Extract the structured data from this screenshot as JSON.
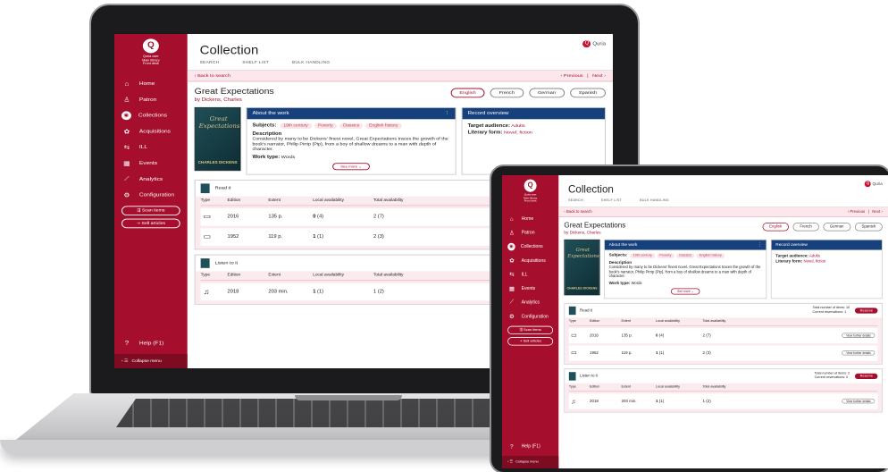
{
  "app": {
    "brand": {
      "lines": [
        "Quria user",
        "Main library",
        "Front desk"
      ],
      "logo_text": "Quria"
    },
    "sidebar": {
      "items": [
        {
          "label": "Home",
          "icon": "home-icon",
          "glyph": "⌂"
        },
        {
          "label": "Patron",
          "icon": "person-icon",
          "glyph": "♙"
        },
        {
          "label": "Collections",
          "icon": "collections-icon",
          "glyph": "◉",
          "active": true
        },
        {
          "label": "Acquisitions",
          "icon": "acquisitions-icon",
          "glyph": "✿"
        },
        {
          "label": "ILL",
          "icon": "ill-icon",
          "glyph": "⇆"
        },
        {
          "label": "Events",
          "icon": "calendar-icon",
          "glyph": "▦"
        },
        {
          "label": "Analytics",
          "icon": "chart-icon",
          "glyph": "⟋"
        },
        {
          "label": "Configuration",
          "icon": "gear-icon",
          "glyph": "⚙"
        }
      ],
      "scan_items": "Scan items",
      "sell_articles": "Sell articles",
      "help": "Help (F1)",
      "collapse": "Collapse menu"
    },
    "header": {
      "title": "Collection",
      "tabs": [
        "SEARCH",
        "SHELF LIST",
        "BULK HANDLING"
      ]
    },
    "crumb": {
      "back": "‹ Back to search",
      "previous": "‹ Previous",
      "divider": "|",
      "next": "Next ›"
    },
    "work": {
      "title": "Great Expectations",
      "author": "by Dickens, Charles",
      "languages": [
        "English",
        "French",
        "German",
        "Spanish"
      ],
      "selected_language": "English",
      "cover": {
        "title": "Great Expectations",
        "author": "CHARLES DICKENS"
      }
    },
    "about": {
      "heading": "About the work",
      "menu": "⋮",
      "subjects_label": "Subjects:",
      "subjects": [
        "19th century",
        "Poverty",
        "Classics",
        "English history"
      ],
      "description_label": "Description",
      "description": "Considered by many to be Dickens' finest novel, Great Expectations traces the growth of the book's narrator, Philip Pirrip (Pip), from a boy of shallow dreams to a man with depth of character.",
      "work_type_label": "Work type:",
      "work_type": "Words",
      "see_more": "See more ⌄"
    },
    "record": {
      "heading": "Record overview",
      "audience_label": "Target audience:",
      "audience": "Adults",
      "form_label": "Literary form:",
      "form": "Novel, fiction"
    },
    "table_headers": [
      "Type",
      "Edition",
      "Extent",
      "Local availability",
      "Total availability"
    ],
    "formats": [
      {
        "label": "Read it",
        "total_items": "Total number of items: 10",
        "reservations": "Current reservations: 1",
        "reserve": "Reserve",
        "rows": [
          {
            "icon": "book-icon",
            "glyph": "▭",
            "edition": "2016",
            "extent": "135 p.",
            "local": "0",
            "local_sub": "(4)",
            "total": "2",
            "total_sub": "(7)",
            "action": "View further details"
          },
          {
            "icon": "book-icon",
            "glyph": "▭",
            "edition": "1952",
            "extent": "119 p.",
            "local": "1",
            "local_sub": "(1)",
            "total": "2",
            "total_sub": "(3)",
            "action": "View further details"
          }
        ]
      },
      {
        "label": "Listen to it",
        "total_items": "Total number of items: 2",
        "reservations": "Current reservations: 0",
        "reserve": "Reserve",
        "rows": [
          {
            "icon": "audiobook-icon",
            "glyph": "♫",
            "edition": "2018",
            "extent": "203 min.",
            "local": "1",
            "local_sub": "(1)",
            "total": "1",
            "total_sub": "(2)",
            "action": "View further details"
          }
        ]
      }
    ]
  },
  "colors": {
    "brand_red": "#a50f2d",
    "header_blue": "#17417c",
    "row_pink": "#fcebee"
  }
}
